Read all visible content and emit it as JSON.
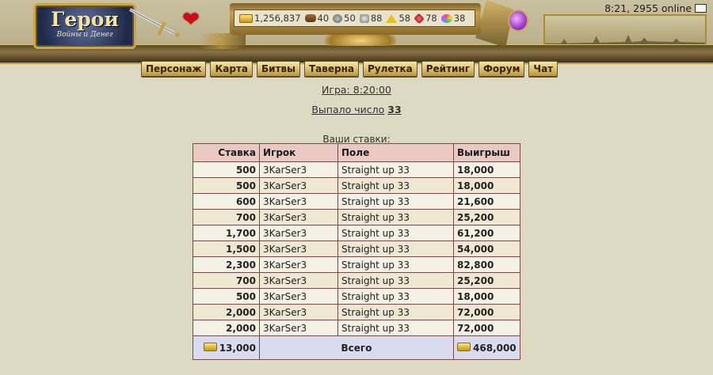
{
  "header": {
    "logo_title": "Герои",
    "logo_subtitle": "Войны и Денег",
    "online": "8:21, 2955 online",
    "resources": [
      {
        "icon": "gold-icon",
        "value": "1,256,837"
      },
      {
        "icon": "wood-icon",
        "value": "40"
      },
      {
        "icon": "ore-icon",
        "value": "50"
      },
      {
        "icon": "mercury-icon",
        "value": "88"
      },
      {
        "icon": "sulfur-icon",
        "value": "58"
      },
      {
        "icon": "crystal-icon",
        "value": "78"
      },
      {
        "icon": "gems-icon",
        "value": "38"
      }
    ]
  },
  "nav": [
    "Персонаж",
    "Карта",
    "Битвы",
    "Таверна",
    "Рулетка",
    "Рейтинг",
    "Форум",
    "Чат"
  ],
  "game_time": "Игра: 8:20:00",
  "result": {
    "label": "Выпало число",
    "number": "33"
  },
  "bets_caption": "Ваши ставки:",
  "table": {
    "headers": [
      "Ставка",
      "Игрок",
      "Поле",
      "Выигрыш"
    ],
    "rows": [
      [
        "500",
        "3KarSer3",
        "Straight up 33",
        "18,000"
      ],
      [
        "500",
        "3KarSer3",
        "Straight up 33",
        "18,000"
      ],
      [
        "600",
        "3KarSer3",
        "Straight up 33",
        "21,600"
      ],
      [
        "700",
        "3KarSer3",
        "Straight up 33",
        "25,200"
      ],
      [
        "1,700",
        "3KarSer3",
        "Straight up 33",
        "61,200"
      ],
      [
        "1,500",
        "3KarSer3",
        "Straight up 33",
        "54,000"
      ],
      [
        "2,300",
        "3KarSer3",
        "Straight up 33",
        "82,800"
      ],
      [
        "700",
        "3KarSer3",
        "Straight up 33",
        "25,200"
      ],
      [
        "500",
        "3KarSer3",
        "Straight up 33",
        "18,000"
      ],
      [
        "2,000",
        "3KarSer3",
        "Straight up 33",
        "72,000"
      ],
      [
        "2,000",
        "3KarSer3",
        "Straight up 33",
        "72,000"
      ]
    ],
    "total": {
      "stake": "13,000",
      "label": "Всего",
      "win": "468,000"
    }
  }
}
